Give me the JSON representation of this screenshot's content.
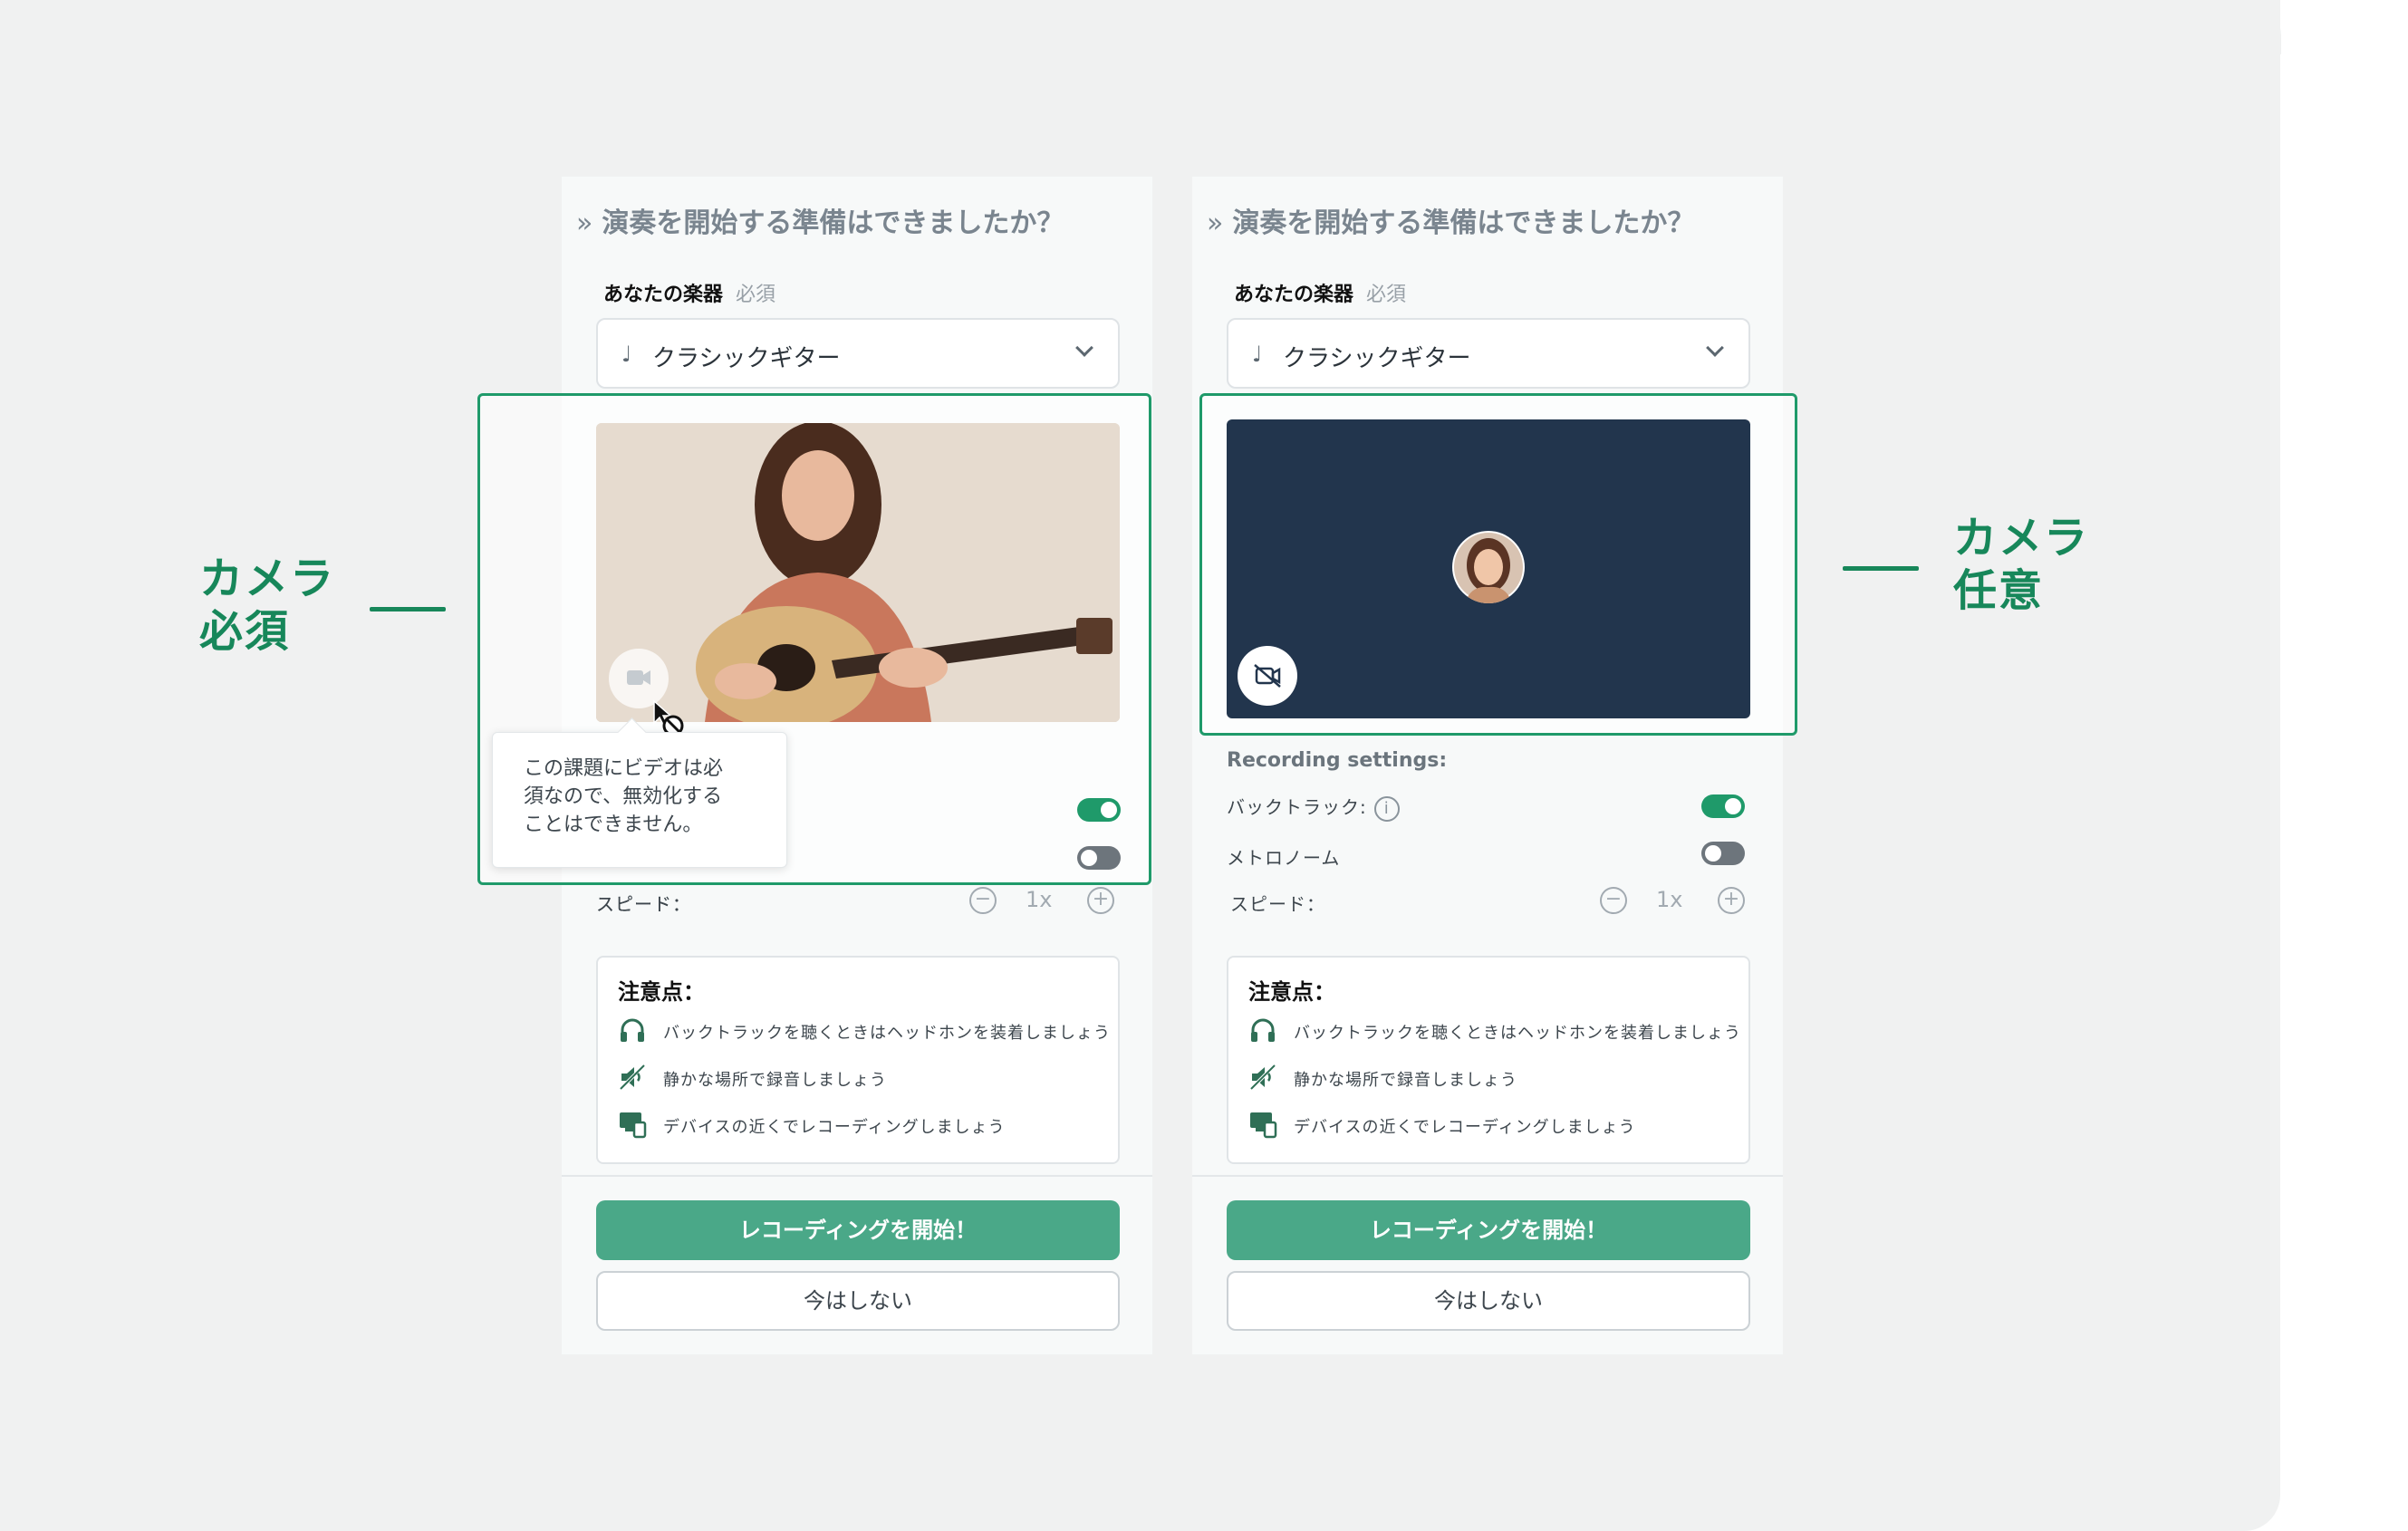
{
  "left_label": [
    "カメラ",
    "必須"
  ],
  "right_label": [
    "カメラ",
    "任意"
  ],
  "colors": {
    "accent": "#17875a",
    "button": "#4aa888",
    "video_bg": "#22354d"
  },
  "panel": {
    "title": "演奏を開始する準備はできましたか？",
    "chevron_icon": "double-chevron-right-icon",
    "instrument_label": "あなたの楽器",
    "instrument_required": "必須",
    "instrument_value": "クラシックギター",
    "instrument_icon": "guitar-icon",
    "recording_settings_title": "Recording settings:",
    "backtrack_label": "バックトラック:",
    "backtrack_on": true,
    "metronome_label": "メトロノーム",
    "metronome_on": false,
    "speed_label": "スピード：",
    "speed_value": "1x",
    "notes_title": "注意点：",
    "notes": [
      {
        "icon": "headphones-icon",
        "text": "バックトラックを聴くときはヘッドホンを装着しましょう"
      },
      {
        "icon": "quiet-icon",
        "text": "静かな場所で録音しましょう"
      },
      {
        "icon": "devices-icon",
        "text": "デバイスの近くでレコーディングしましょう"
      }
    ],
    "primary_button": "レコーディングを開始！",
    "secondary_button": "今はしない"
  },
  "tooltip": [
    "この課題にビデオは必",
    "須なので、無効化する",
    "ことはできません。"
  ]
}
